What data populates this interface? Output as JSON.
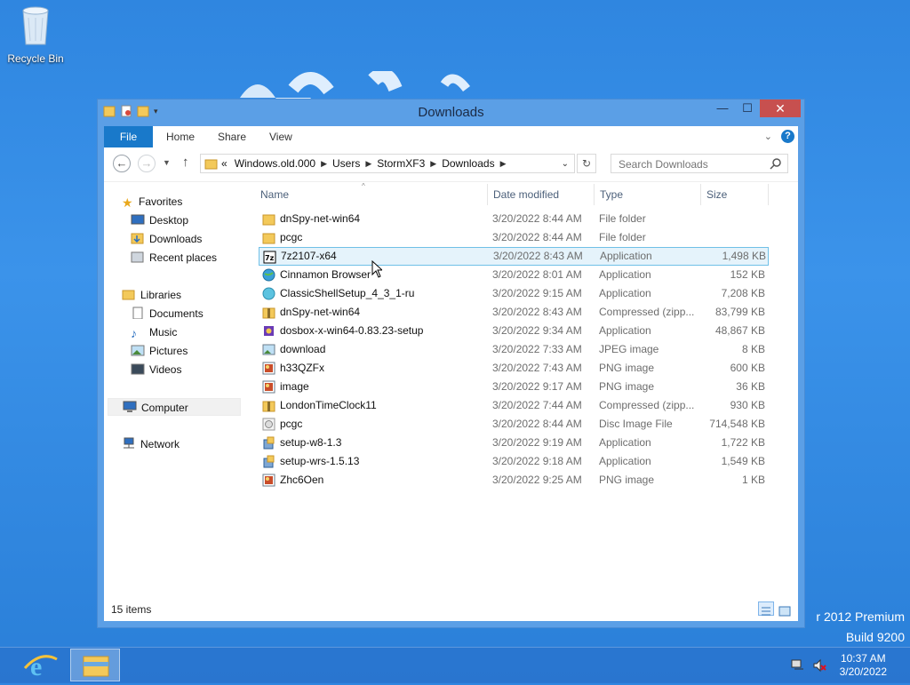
{
  "desktop": {
    "recycle_bin_label": "Recycle Bin",
    "watermark_line1": "r 2012 Premium",
    "watermark_line2": "Build 9200"
  },
  "window": {
    "title": "Downloads",
    "minimize_icon": "minimize-icon",
    "maximize_icon": "maximize-icon",
    "close_icon": "close-icon"
  },
  "ribbon": {
    "tabs": [
      "File",
      "Home",
      "Share",
      "View"
    ]
  },
  "address": {
    "lead": "«",
    "crumbs": [
      "Windows.old.000",
      "Users",
      "StormXF3",
      "Downloads"
    ],
    "search_placeholder": "Search Downloads"
  },
  "nav": {
    "favorites": "Favorites",
    "desktop": "Desktop",
    "downloads": "Downloads",
    "recent": "Recent places",
    "libraries": "Libraries",
    "documents": "Documents",
    "music": "Music",
    "pictures": "Pictures",
    "videos": "Videos",
    "computer": "Computer",
    "network": "Network"
  },
  "columns": {
    "name": "Name",
    "date": "Date modified",
    "type": "Type",
    "size": "Size"
  },
  "files": [
    {
      "name": "dnSpy-net-win64",
      "date": "3/20/2022 8:44 AM",
      "type": "File folder",
      "size": "",
      "icon": "folder-icon"
    },
    {
      "name": "pcgc",
      "date": "3/20/2022 8:44 AM",
      "type": "File folder",
      "size": "",
      "icon": "folder-icon"
    },
    {
      "name": "7z2107-x64",
      "date": "3/20/2022 8:43 AM",
      "type": "Application",
      "size": "1,498 KB",
      "icon": "7zip-icon"
    },
    {
      "name": "Cinnamon Browser",
      "date": "3/20/2022 8:01 AM",
      "type": "Application",
      "size": "152 KB",
      "icon": "globe-icon"
    },
    {
      "name": "ClassicShellSetup_4_3_1-ru",
      "date": "3/20/2022 9:15 AM",
      "type": "Application",
      "size": "7,208 KB",
      "icon": "shell-icon"
    },
    {
      "name": "dnSpy-net-win64",
      "date": "3/20/2022 8:43 AM",
      "type": "Compressed (zipp...",
      "size": "83,799 KB",
      "icon": "zip-folder-icon"
    },
    {
      "name": "dosbox-x-win64-0.83.23-setup",
      "date": "3/20/2022 9:34 AM",
      "type": "Application",
      "size": "48,867 KB",
      "icon": "dosbox-icon"
    },
    {
      "name": "download",
      "date": "3/20/2022 7:33 AM",
      "type": "JPEG image",
      "size": "8 KB",
      "icon": "jpeg-icon"
    },
    {
      "name": "h33QZFx",
      "date": "3/20/2022 7:43 AM",
      "type": "PNG image",
      "size": "600 KB",
      "icon": "png-icon"
    },
    {
      "name": "image",
      "date": "3/20/2022 9:17 AM",
      "type": "PNG image",
      "size": "36 KB",
      "icon": "png-icon"
    },
    {
      "name": "LondonTimeClock11",
      "date": "3/20/2022 7:44 AM",
      "type": "Compressed (zipp...",
      "size": "930 KB",
      "icon": "zip-folder-icon"
    },
    {
      "name": "pcgc",
      "date": "3/20/2022 8:44 AM",
      "type": "Disc Image File",
      "size": "714,548 KB",
      "icon": "disc-icon"
    },
    {
      "name": "setup-w8-1.3",
      "date": "3/20/2022 9:19 AM",
      "type": "Application",
      "size": "1,722 KB",
      "icon": "setup-icon"
    },
    {
      "name": "setup-wrs-1.5.13",
      "date": "3/20/2022 9:18 AM",
      "type": "Application",
      "size": "1,549 KB",
      "icon": "setup-icon"
    },
    {
      "name": "Zhc6Oen",
      "date": "3/20/2022 9:25 AM",
      "type": "PNG image",
      "size": "1 KB",
      "icon": "png-icon"
    }
  ],
  "status": {
    "count": "15 items"
  },
  "taskbar": {
    "time": "10:37 AM",
    "date": "3/20/2022"
  },
  "colors": {
    "accent": "#1979ca",
    "close_red": "#c7504f",
    "title_bar": "#5b9fe6",
    "hover_bg": "#e5f3fb",
    "hover_border": "#70c0e7"
  }
}
